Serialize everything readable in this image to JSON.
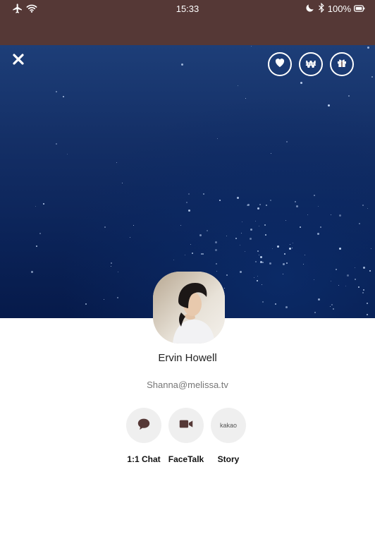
{
  "status_bar": {
    "time": "15:33",
    "battery": "100%",
    "icons": [
      "airplane-icon",
      "wifi-icon",
      "moon-icon",
      "bluetooth-icon",
      "battery-icon"
    ]
  },
  "header": {
    "close_icon": "close-icon",
    "actions": [
      {
        "icon": "heart-icon"
      },
      {
        "icon": "won-icon",
        "glyph": "₩"
      },
      {
        "icon": "gift-icon"
      }
    ]
  },
  "profile": {
    "name": "Ervin Howell",
    "email": "Shanna@melissa.tv"
  },
  "actions": [
    {
      "label": "1:1 Chat",
      "icon": "chat-bubble-icon"
    },
    {
      "label": "FaceTalk",
      "icon": "video-camera-icon"
    },
    {
      "label": "Story",
      "icon": "kakao-icon",
      "icon_text": "kakao"
    }
  ],
  "colors": {
    "status_bar": "#553836",
    "hero_top": "#1d3e78",
    "hero_bottom": "#061a4a",
    "action_bg": "#efefef",
    "icon_dark": "#553836"
  }
}
